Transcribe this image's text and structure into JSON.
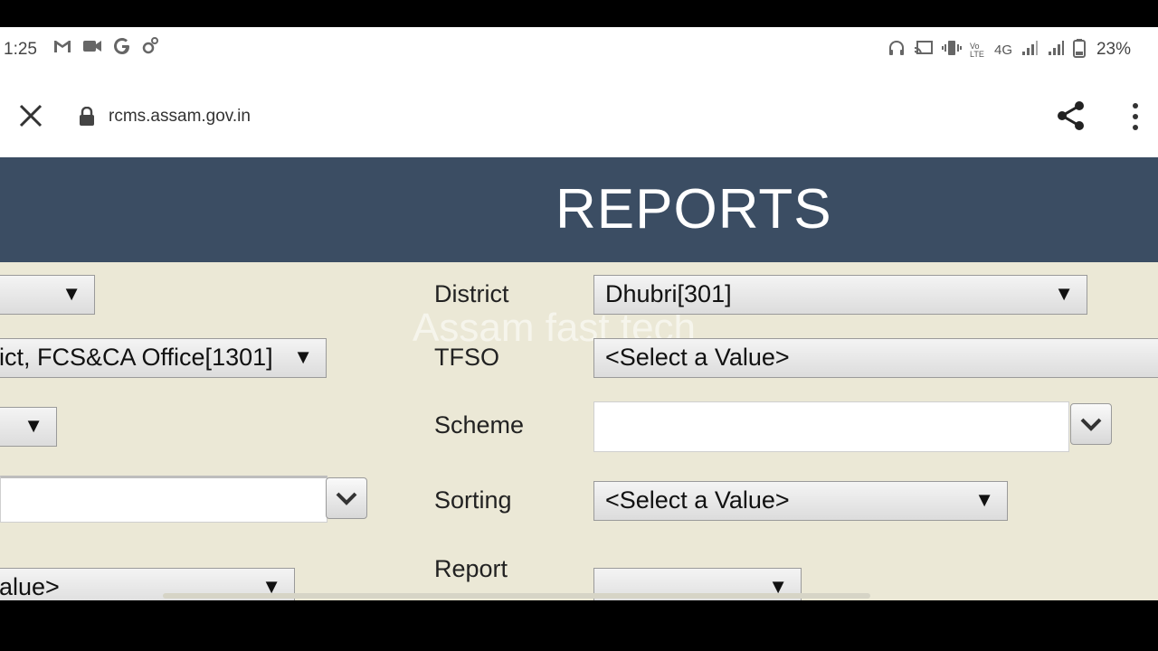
{
  "status_bar": {
    "time": "1:25",
    "left_icons": [
      "gmail-icon",
      "video-icon",
      "google-icon",
      "settings-icon"
    ],
    "right_icons": [
      "headphones-icon",
      "cast-icon",
      "vibrate-icon",
      "volte-icon",
      "4g-icon",
      "signal-icon",
      "signal-icon",
      "battery-icon"
    ],
    "volte_label": "Vo LTE",
    "network_label": "4G",
    "battery_percent": "23%"
  },
  "browser": {
    "url": "rcms.assam.gov.in"
  },
  "header": {
    "title": "REPORTS"
  },
  "watermark": "Assam fast tech",
  "left_column": {
    "select_1": {
      "value": ""
    },
    "select_2": {
      "value": "ict, FCS&CA Office[1301]"
    },
    "select_3": {
      "value": ""
    },
    "select_5": {
      "value": "alue>"
    }
  },
  "form": {
    "district": {
      "label": "District",
      "value": "Dhubri[301]"
    },
    "tfso": {
      "label": "TFSO",
      "value": "<Select a Value>"
    },
    "scheme": {
      "label": "Scheme",
      "value": ""
    },
    "sorting": {
      "label": "Sorting",
      "value": "<Select a Value>"
    },
    "report": {
      "label": "Report",
      "value": ""
    }
  },
  "colors": {
    "header_bg": "#3b4d63",
    "content_bg": "#ebe8d6"
  }
}
